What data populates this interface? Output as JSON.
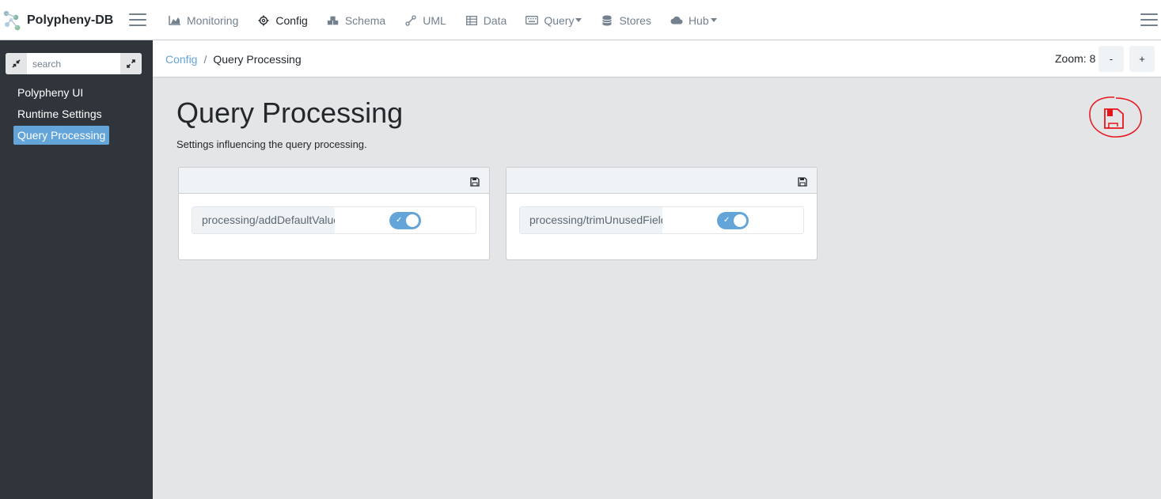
{
  "app": {
    "name": "Polypheny-DB"
  },
  "nav": {
    "items": [
      {
        "label": "Monitoring",
        "icon": "chart-area-icon"
      },
      {
        "label": "Config",
        "icon": "cog-icon"
      },
      {
        "label": "Schema",
        "icon": "cubes-icon"
      },
      {
        "label": "UML",
        "icon": "project-diagram-icon"
      },
      {
        "label": "Data",
        "icon": "table-icon"
      },
      {
        "label": "Query",
        "icon": "keyboard-icon"
      },
      {
        "label": "Stores",
        "icon": "database-icon"
      },
      {
        "label": "Hub",
        "icon": "cloud-icon"
      }
    ]
  },
  "sidebar": {
    "search_placeholder": "search",
    "items": [
      {
        "label": "Polypheny UI"
      },
      {
        "label": "Runtime Settings"
      },
      {
        "label": "Query Processing"
      }
    ]
  },
  "breadcrumb": {
    "root": "Config",
    "separator": "/",
    "current": "Query Processing"
  },
  "zoom": {
    "label": "Zoom: 8",
    "minus": "-",
    "plus": "+"
  },
  "page": {
    "title": "Query Processing",
    "description": "Settings influencing the query processing."
  },
  "cards": [
    {
      "setting": "processing/addDefaultValues",
      "enabled": true,
      "check": "✓"
    },
    {
      "setting": "processing/trimUnusedFields",
      "enabled": true,
      "check": "✓"
    }
  ],
  "colors": {
    "accent": "#63a5d8",
    "sidebar": "#2f353a",
    "annotation": "#e8141c"
  }
}
